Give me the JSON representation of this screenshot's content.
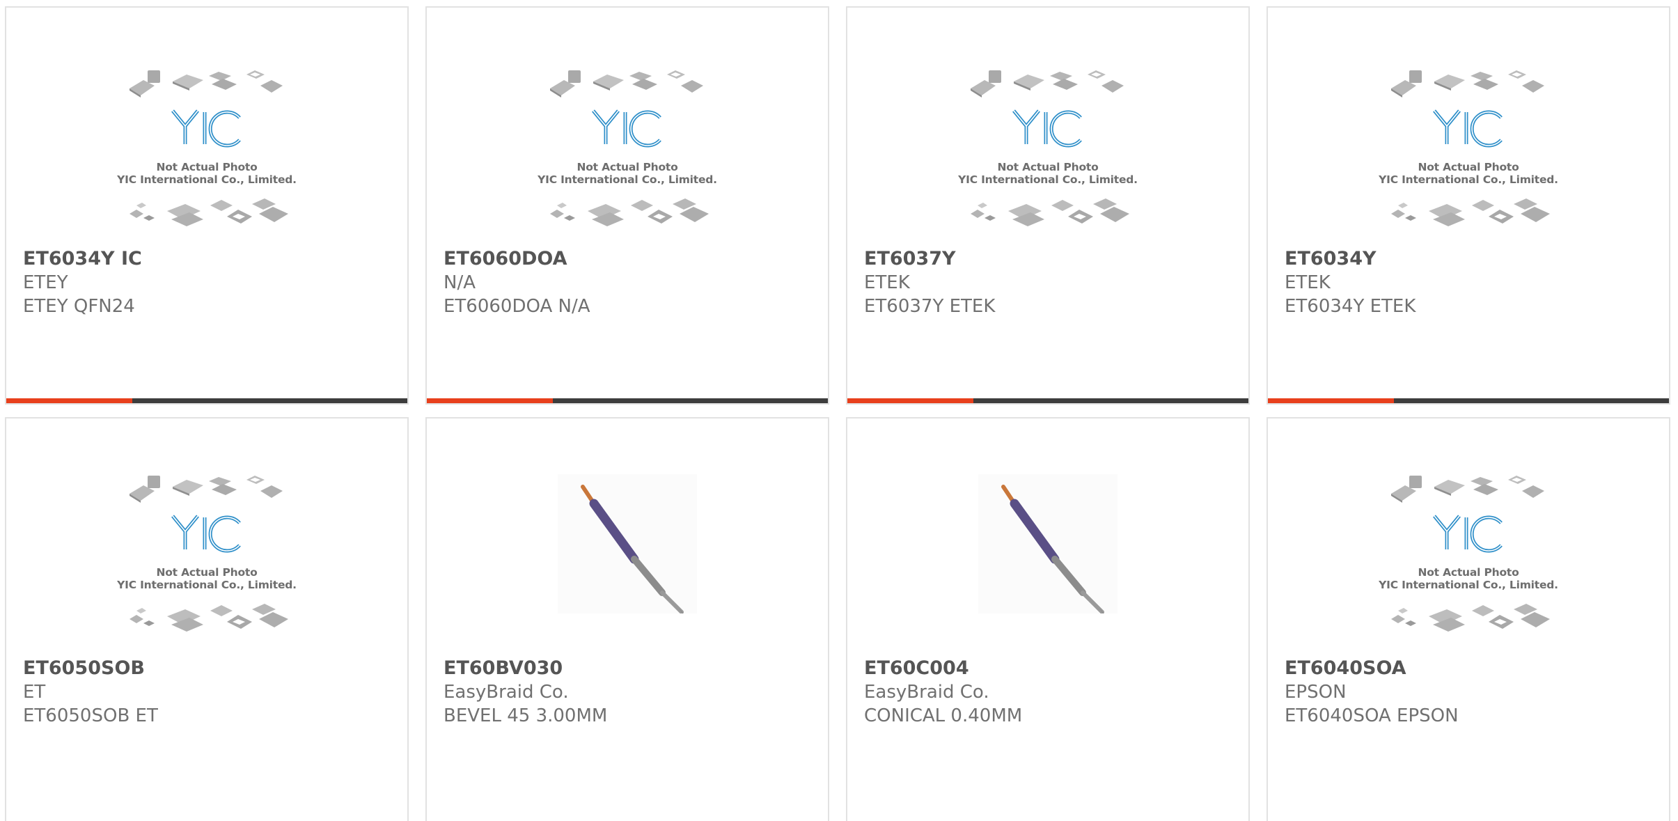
{
  "placeholder": {
    "line1": "Not Actual Photo",
    "line2": "YIC International Co., Limited.",
    "logo_text": "YIC"
  },
  "colors": {
    "accent": "#e8401c",
    "bar_track": "#3d3d3d",
    "logo_blue": "#2e8fc9",
    "card_border": "#e2e2e2"
  },
  "products": [
    {
      "part": "ET6034Y IC",
      "manufacturer": "ETEY",
      "description": "ETEY QFN24",
      "image": "not-actual-photo"
    },
    {
      "part": "ET6060DOA",
      "manufacturer": "N/A",
      "description": "ET6060DOA N/A",
      "image": "not-actual-photo"
    },
    {
      "part": "ET6037Y",
      "manufacturer": "ETEK",
      "description": "ET6037Y ETEK",
      "image": "not-actual-photo"
    },
    {
      "part": "ET6034Y",
      "manufacturer": "ETEK",
      "description": "ET6034Y ETEK",
      "image": "not-actual-photo"
    },
    {
      "part": "ET6050SOB",
      "manufacturer": "ET",
      "description": "ET6050SOB ET",
      "image": "not-actual-photo"
    },
    {
      "part": "ET60BV030",
      "manufacturer": "EasyBraid Co.",
      "description": "BEVEL 45 3.00MM",
      "image": "solder-tip"
    },
    {
      "part": "ET60C004",
      "manufacturer": "EasyBraid Co.",
      "description": "CONICAL 0.40MM",
      "image": "solder-tip"
    },
    {
      "part": "ET6040SOA",
      "manufacturer": "EPSON",
      "description": "ET6040SOA EPSON",
      "image": "not-actual-photo"
    }
  ],
  "progress": {
    "fraction": 0.315
  }
}
